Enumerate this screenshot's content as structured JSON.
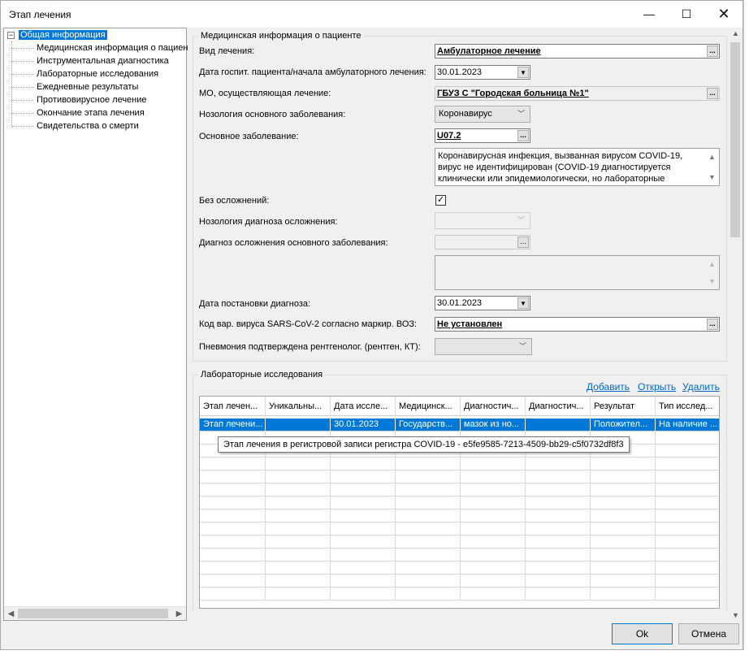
{
  "window": {
    "title": "Этап лечения",
    "minimize_glyph": "—",
    "maximize_glyph": "☐",
    "close_glyph": "✕"
  },
  "tree": {
    "root": {
      "expander": "−",
      "label": "Общая информация"
    },
    "items": [
      {
        "label": "Медицинская информация о пациен"
      },
      {
        "label": "Инструментальная диагностика"
      },
      {
        "label": "Лабораторные исследования"
      },
      {
        "label": "Ежедневные результаты"
      },
      {
        "label": "Противовирусное лечение"
      },
      {
        "label": "Окончание этапа лечения"
      },
      {
        "label": "Свидетельства о смерти"
      }
    ]
  },
  "med_info": {
    "section_title": "Медицинская информация о пациенте",
    "vid_lecheniya": {
      "label": "Вид лечения:",
      "value": "Амбулаторное лечение"
    },
    "data_gospit": {
      "label": "Дата госпит. пациента/начала амбулаторного лечения:",
      "value": "30.01.2023"
    },
    "mo": {
      "label": "МО, осуществляющая лечение:",
      "value": "ГБУЗ С \"Городская больница №1\""
    },
    "nozologiya": {
      "label": "Нозология основного заболевания:",
      "value": "Коронавирус"
    },
    "osnovnoe": {
      "label": "Основное заболевание:",
      "code": "U07.2",
      "description": "Коронавирусная инфекция, вызванная вирусом COVID-19, вирус не идентифицирован (COVID-19 диагностируется клинически или эпидемиологически, но лабораторные"
    },
    "bez_oslozhneniy": {
      "label": "Без осложнений:",
      "checked": true,
      "check_glyph": "✓"
    },
    "nozologiya_osl": {
      "label": "Нозология диагноза осложнения:",
      "value": ""
    },
    "diagnoz_osl": {
      "label": "Диагноз осложнения основного заболевания:",
      "value": ""
    },
    "data_diagnoza": {
      "label": "Дата постановки диагноза:",
      "value": "30.01.2023"
    },
    "kod_virusa": {
      "label": "Код вар. вируса SARS-CoV-2 согласно маркир. ВОЗ:",
      "value": "Не установлен"
    },
    "pnevmoniya": {
      "label": "Пневмония подтверждена рентгенолог. (рентген, КТ):",
      "value": ""
    }
  },
  "lab": {
    "section_title": "Лабораторные исследования",
    "actions": {
      "add": "Добавить",
      "open": "Открыть",
      "delete": "Удалить"
    },
    "columns": [
      "Этап лечен...",
      "Уникальны...",
      "Дата иссле...",
      "Медицинск...",
      "Диагностич...",
      "Диагностич...",
      "Результат",
      "Тип исслед..."
    ],
    "rows": [
      [
        "Этап лечени...",
        "",
        "30.01.2023",
        "Государств...",
        "мазок из но...",
        "",
        "Положител...",
        "На наличие ..."
      ]
    ],
    "tooltip": "Этап лечения в регистровой записи регистра COVID-19 - e5fe9585-7213-4509-bb29-c5f0732df8f3"
  },
  "buttons": {
    "ok": "Ok",
    "cancel": "Отмена"
  },
  "icons": {
    "ellipsis": "...",
    "dropdown": "▼",
    "chevron": "﹀",
    "up": "▲",
    "down": "▼",
    "left": "◀",
    "right": "▶"
  }
}
